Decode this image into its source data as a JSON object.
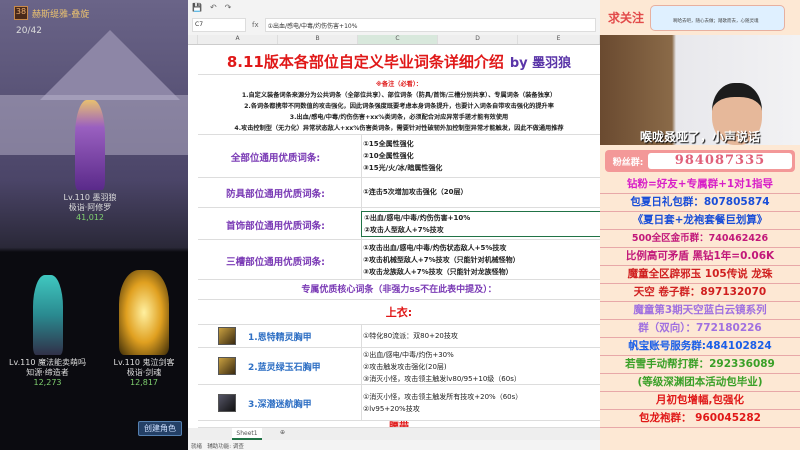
{
  "game": {
    "guild_level": "38",
    "guild_name": "赫斯缇雅-叠旋",
    "member_count": "20/42",
    "characters": [
      {
        "level": "Lv.110",
        "name": "墨羽狼",
        "job": "极诣·阿修罗",
        "power": "41,012"
      },
      {
        "level": "Lv.110",
        "name": "魔法能卖萌吗",
        "job": "知源·缔造者",
        "power": "12,273"
      },
      {
        "level": "Lv.110",
        "name": "鬼泣剑客",
        "job": "极诣·剑魂",
        "power": "12,817"
      }
    ],
    "create_button": "创建角色"
  },
  "sheet": {
    "cell_ref": "C7",
    "formula": "①出血/感电/中毒/灼伤伤害+10%",
    "columns": [
      "A",
      "B",
      "C",
      "D",
      "E"
    ],
    "title": "8.11版本各部位自定义毕业词条详细介绍",
    "author": "by  墨羽狼",
    "note_header": "※备注（必看）：",
    "notes": [
      "1.自定义装备词条来源分为公共词条（全部位共享）、部位词条（防具/首饰/三槽分别共享）、专属词条（装备独享）",
      "2.各词条都携带不同数值的攻击强化，因此词条强度既要考虑本身词条提升，也要计入词条自带攻击强化的提升率",
      "3.出血/感电/中毒/灼伤伤害+xx%类词条，必须配合对应异常手搓才能有效使用",
      "4.攻击控制型（无力化）异常状态敌人+xx%伤害类词条，需要针对性破韧外加控制型异常才能触发，因此不做通用推荐"
    ],
    "sections": [
      {
        "label": "全部位通用优质词条:",
        "values": [
          "①15全属性强化",
          "②10全属性强化",
          "③15光/火/冰/暗属性强化"
        ]
      },
      {
        "label": "防具部位通用优质词条:",
        "values": [
          "①连击5次增加攻击强化（20层）"
        ]
      },
      {
        "label": "首饰部位通用优质词条:",
        "values": [
          "①出血/感电/中毒/灼伤伤害+10%",
          "②攻击人型敌人+7%技攻"
        ]
      },
      {
        "label": "三槽部位通用优质词条:",
        "values": [
          "①攻击出血/感电/中毒/灼伤状态敌人+5%技攻",
          "②攻击机械型敌人+7%技攻（只能针对机械怪物）",
          "③攻击龙族敌人+7%技攻（只能针对龙族怪物）"
        ]
      }
    ],
    "exclusive_header": "专属优质核心词条（非强力ss不在此表中提及）：",
    "top_header": "上衣:",
    "items": [
      {
        "name": "1.恩特精灵胸甲",
        "values": [
          "①特化80流派：双80+20技攻"
        ]
      },
      {
        "name": "2.蓝灵绿玉石胸甲",
        "values": [
          "①出血/感电/中毒/灼伤+30%",
          "②攻击触发攻击强化(20层)",
          "③消灭小怪，攻击领主触发lv80/95+10级（60s）"
        ]
      },
      {
        "name": "3.深潜迷航胸甲",
        "values": [
          "①消灭小怪，攻击领主触发所有技攻+20%（60s）",
          "②lv95+20%技攻"
        ]
      }
    ],
    "next_header": "腰带",
    "sheet_tab": "Sheet1",
    "status_ready": "就绪",
    "status_access": "辅助功能: 调查"
  },
  "stream": {
    "follow": "求关注",
    "card_text": "啊哈去吧，随心去做；踏歌而去，心随灵魂",
    "subtitle": "喉咙叒哑了，小声说话",
    "fan_label": "粉丝群:",
    "fan_number": "984087335",
    "ads": [
      {
        "text": "钻粉=好友+专属群+1对1指导",
        "color": "#d81ec8"
      },
      {
        "text": "包夏日礼包群：807805874",
        "color": "#1a4ed8"
      },
      {
        "text": "《夏日套+龙袍套餐巨划算》",
        "color": "#1a4ed8"
      },
      {
        "text": "500全区金币群：740462426",
        "color": "#c2187a"
      },
      {
        "text": "比例高可矛盾 黑钻1年=0.06K",
        "color": "#c2187a"
      },
      {
        "text": "魔童全区辟邪玉 105传说 龙珠",
        "color": "#d02020"
      },
      {
        "text": "天空 卷子群：897132070",
        "color": "#d02020"
      },
      {
        "text": "魔童第3期天空蓝白云镜系列",
        "color": "#a070e0"
      },
      {
        "text": "群（双向）：772180226",
        "color": "#a070e0"
      },
      {
        "text": "帆宝账号服务群:484102824",
        "color": "#1a5ee8"
      },
      {
        "text": "若雪手动帮打群：292336089",
        "color": "#3aa028"
      },
      {
        "text": "(等级深渊团本活动包毕业)",
        "color": "#3aa028"
      },
      {
        "text": "月初包增幅,包强化",
        "color": "#e01818"
      },
      {
        "text": "包龙袍群： 960045282",
        "color": "#e01818"
      }
    ]
  }
}
